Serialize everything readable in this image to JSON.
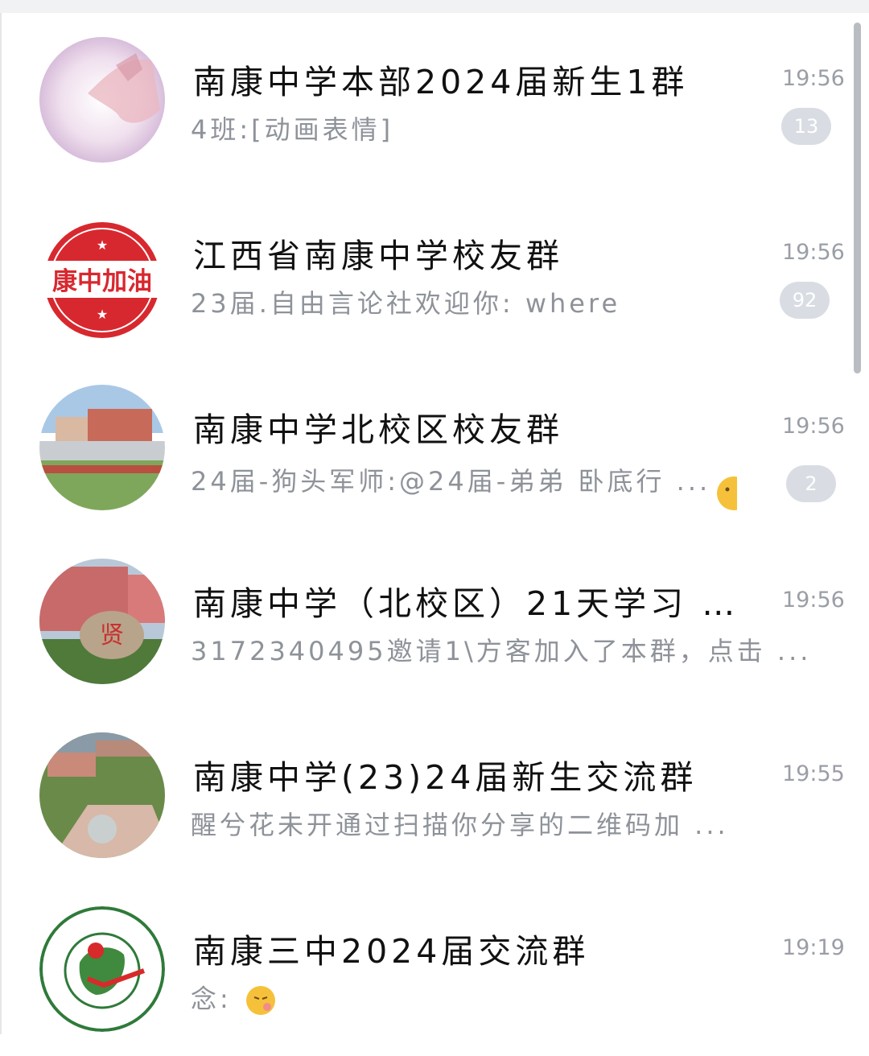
{
  "chats": [
    {
      "title": "南康中学本部2024届新生1群",
      "time": "19:56",
      "preview": "4班:[动画表情]",
      "badge": "13"
    },
    {
      "title": "江西省南康中学校友群",
      "time": "19:56",
      "preview": "23届.自由言论社欢迎你: where",
      "badge": "92"
    },
    {
      "title": "南康中学北校区校友群",
      "time": "19:56",
      "preview": "24届-狗头军师:@24届-弟弟 卧底行 ...",
      "badge": "2"
    },
    {
      "title": "南康中学（北校区）21天学习 ...",
      "time": "19:56",
      "preview": "3172340495邀请1\\方客加入了本群，点击 ..."
    },
    {
      "title": "南康中学(23)24届新生交流群",
      "time": "19:55",
      "preview": "醒兮花未开通过扫描你分享的二维码加 ..."
    },
    {
      "title": "南康三中2024届交流群",
      "time": "19:19",
      "preview": "念:"
    }
  ],
  "logo_texts": {
    "kangzhong": "康中加油"
  },
  "colors": {
    "badge": "#d9dde3",
    "time": "#9a9ea6",
    "preview": "#8e9299"
  }
}
